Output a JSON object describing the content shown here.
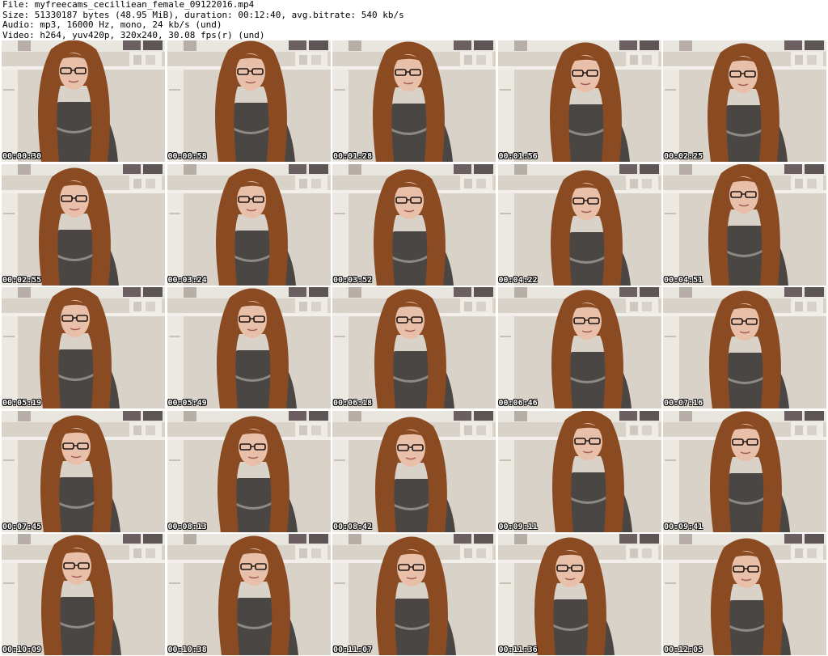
{
  "info": {
    "file_line": "File: myfreecams_cecilliean_female_09122016.mp4",
    "size_line": "Size: 51330187 bytes (48.95 MiB), duration: 00:12:40, avg.bitrate: 540 kb/s",
    "audio_line": "Audio: mp3, 16000 Hz, mono, 24 kb/s (und)",
    "video_line": "Video: h264, yuv420p, 320x240, 30.08 fps(r) (und)"
  },
  "thumbnails": [
    {
      "timestamp": "00:00:30"
    },
    {
      "timestamp": "00:00:58"
    },
    {
      "timestamp": "00:01:28"
    },
    {
      "timestamp": "00:01:56"
    },
    {
      "timestamp": "00:02:25"
    },
    {
      "timestamp": "00:02:55"
    },
    {
      "timestamp": "00:03:24"
    },
    {
      "timestamp": "00:03:52"
    },
    {
      "timestamp": "00:04:22"
    },
    {
      "timestamp": "00:04:51"
    },
    {
      "timestamp": "00:05:19"
    },
    {
      "timestamp": "00:05:49"
    },
    {
      "timestamp": "00:06:18"
    },
    {
      "timestamp": "00:06:46"
    },
    {
      "timestamp": "00:07:16"
    },
    {
      "timestamp": "00:07:45"
    },
    {
      "timestamp": "00:08:13"
    },
    {
      "timestamp": "00:08:42"
    },
    {
      "timestamp": "00:09:11"
    },
    {
      "timestamp": "00:09:41"
    },
    {
      "timestamp": "00:10:09"
    },
    {
      "timestamp": "00:10:38"
    },
    {
      "timestamp": "00:11:07"
    },
    {
      "timestamp": "00:11:36"
    },
    {
      "timestamp": "00:12:05"
    }
  ],
  "colors": {
    "wall": "#d9d2c8",
    "shelf": "#f2efea",
    "hair": "#8a4a22",
    "sweater": "#4a4644",
    "skin": "#e8bfa8"
  }
}
